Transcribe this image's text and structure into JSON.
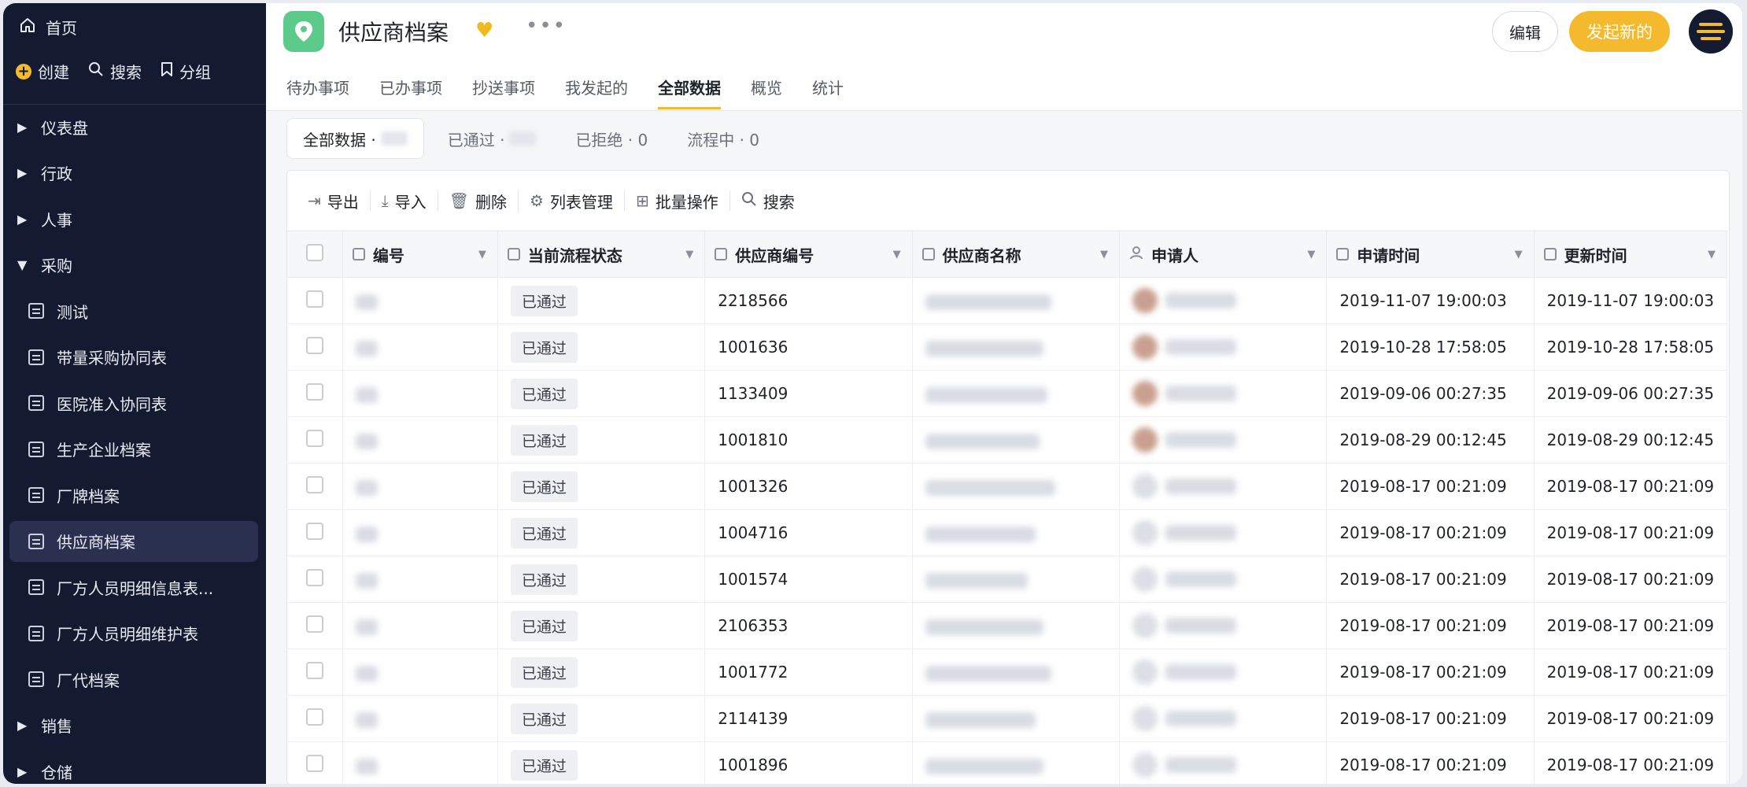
{
  "sidebar": {
    "home_label": "首页",
    "actions": {
      "create": "创建",
      "search": "搜索",
      "group": "分组"
    },
    "groups_top": [
      {
        "label": "仪表盘"
      },
      {
        "label": "行政"
      },
      {
        "label": "人事"
      }
    ],
    "expanded_group": {
      "label": "采购"
    },
    "children": [
      {
        "label": "测试"
      },
      {
        "label": "带量采购协同表"
      },
      {
        "label": "医院准入协同表"
      },
      {
        "label": "生产企业档案"
      },
      {
        "label": "厂牌档案"
      },
      {
        "label": "供应商档案"
      },
      {
        "label": "厂方人员明细信息表..."
      },
      {
        "label": "厂方人员明细维护表"
      },
      {
        "label": "厂代档案"
      }
    ],
    "groups_bottom": [
      {
        "label": "销售"
      },
      {
        "label": "仓储"
      }
    ]
  },
  "header": {
    "title": "供应商档案",
    "edit_label": "编辑",
    "new_label": "发起新的",
    "more_label": "•••",
    "tabs": [
      {
        "label": "待办事项"
      },
      {
        "label": "已办事项"
      },
      {
        "label": "抄送事项"
      },
      {
        "label": "我发起的"
      },
      {
        "label": "全部数据"
      },
      {
        "label": "概览"
      },
      {
        "label": "统计"
      }
    ]
  },
  "filters": {
    "all": "全部数据 ·",
    "approved": "已通过 ·",
    "rejected": "已拒绝 · 0",
    "in_process": "流程中 · 0"
  },
  "toolbar": {
    "export": "导出",
    "import": "导入",
    "delete": "删除",
    "columns": "列表管理",
    "batch": "批量操作",
    "search": "搜索"
  },
  "table": {
    "columns": {
      "id": "编号",
      "status": "当前流程状态",
      "supplier_no": "供应商编号",
      "supplier_name": "供应商名称",
      "applicant": "申请人",
      "apply_time": "申请时间",
      "update_time": "更新时间"
    },
    "rows": [
      {
        "status": "已通过",
        "supplier_no": "2218566",
        "apply_time": "2019-11-07 19:00:03",
        "update_time": "2019-11-07 19:00:03"
      },
      {
        "status": "已通过",
        "supplier_no": "1001636",
        "apply_time": "2019-10-28 17:58:05",
        "update_time": "2019-10-28 17:58:05"
      },
      {
        "status": "已通过",
        "supplier_no": "1133409",
        "apply_time": "2019-09-06 00:27:35",
        "update_time": "2019-09-06 00:27:35"
      },
      {
        "status": "已通过",
        "supplier_no": "1001810",
        "apply_time": "2019-08-29 00:12:45",
        "update_time": "2019-08-29 00:12:45"
      },
      {
        "status": "已通过",
        "supplier_no": "1001326",
        "apply_time": "2019-08-17 00:21:09",
        "update_time": "2019-08-17 00:21:09"
      },
      {
        "status": "已通过",
        "supplier_no": "1004716",
        "apply_time": "2019-08-17 00:21:09",
        "update_time": "2019-08-17 00:21:09"
      },
      {
        "status": "已通过",
        "supplier_no": "1001574",
        "apply_time": "2019-08-17 00:21:09",
        "update_time": "2019-08-17 00:21:09"
      },
      {
        "status": "已通过",
        "supplier_no": "2106353",
        "apply_time": "2019-08-17 00:21:09",
        "update_time": "2019-08-17 00:21:09"
      },
      {
        "status": "已通过",
        "supplier_no": "1001772",
        "apply_time": "2019-08-17 00:21:09",
        "update_time": "2019-08-17 00:21:09"
      },
      {
        "status": "已通过",
        "supplier_no": "2114139",
        "apply_time": "2019-08-17 00:21:09",
        "update_time": "2019-08-17 00:21:09"
      },
      {
        "status": "已通过",
        "supplier_no": "1001896",
        "apply_time": "2019-08-17 00:21:09",
        "update_time": "2019-08-17 00:21:09"
      }
    ]
  }
}
